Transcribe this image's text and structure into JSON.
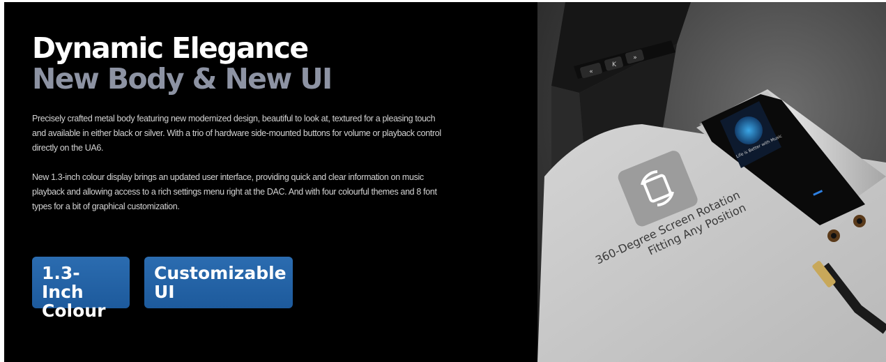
{
  "hero": {
    "title_line1": "Dynamic Elegance",
    "title_line2": "New Body & New UI",
    "paragraph1": "Precisely crafted metal body featuring new modernized design, beautiful to look at, textured for a pleasing touch and available in either black or silver. With a trio of hardware side-mounted buttons for volume or playback control directly on the UA6.",
    "paragraph2": "New 1.3-inch colour display brings an updated user interface, providing quick and clear information on music playback and allowing access to a rich settings menu right at the DAC. And with four colourful themes and 8 font types for a bit of graphical customization."
  },
  "badges": [
    {
      "line1": "1.3-Inch",
      "line2": "Colour"
    },
    {
      "line1": "Customizable",
      "line2": "UI"
    }
  ],
  "photo": {
    "rotation_line1": "360-Degree Screen Rotation",
    "rotation_line2": "Fitting Any Position",
    "screen_text": "Life is Better with Music"
  },
  "colors": {
    "background": "#000000",
    "title_primary": "#ffffff",
    "title_secondary": "#8d93a3",
    "badge": "#2563a6"
  }
}
